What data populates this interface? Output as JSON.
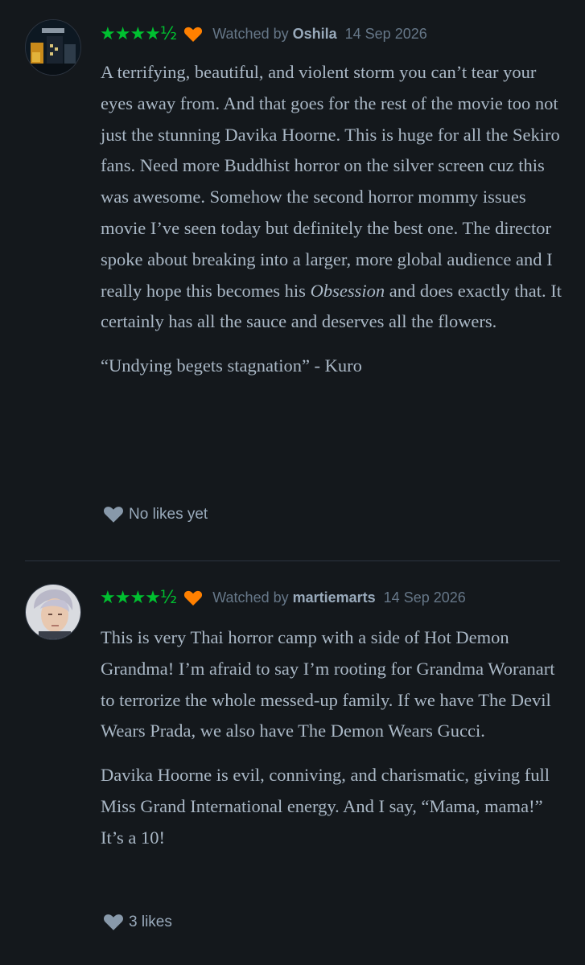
{
  "reviews": [
    {
      "rating_stars": "★★★★½",
      "liked": true,
      "watched_label": "Watched by",
      "username": "Oshila",
      "date": "14 Sep 2026",
      "paragraphs": [
        "A terrifying, beautiful, and violent storm you can’t tear your eyes away from. And that goes for the rest of the movie too not just the stunning Davika Hoorne. This is huge for all the Sekiro fans. Need more Buddhist horror on the silver screen cuz this was awesome. Somehow the second horror mommy issues movie I’ve seen today but definitely the best one. The director spoke about breaking into a larger, more global audience and I really hope this becomes his",
        "Obsession",
        "and does exactly that. It certainly has all the sauce and deserves all the flowers.",
        "“Undying begets stagnation” - Kuro"
      ],
      "likes_label": "No likes yet"
    },
    {
      "rating_stars": "★★★★½",
      "liked": true,
      "watched_label": "Watched by",
      "username": "martiemarts",
      "date": "14 Sep 2026",
      "paragraphs": [
        "This is very Thai horror camp with a side of Hot Demon Grandma! I’m afraid to say I’m rooting for Grandma Woranart to terrorize the whole messed-up family. If we have The Devil Wears Prada, we also have The Demon Wears Gucci.",
        "Davika Hoorne is evil, conniving, and charismatic, giving full Miss Grand International energy. And I say, “Mama, mama!” It’s a 10!"
      ],
      "likes_label": "3 likes"
    }
  ],
  "colors": {
    "background": "#14181c",
    "star_green": "#00c030",
    "heart_orange": "#ff8000",
    "divider": "#2c3440"
  },
  "icons": {
    "rating": "star-icon",
    "liked": "heart-icon",
    "likes": "heart-outline-icon"
  }
}
